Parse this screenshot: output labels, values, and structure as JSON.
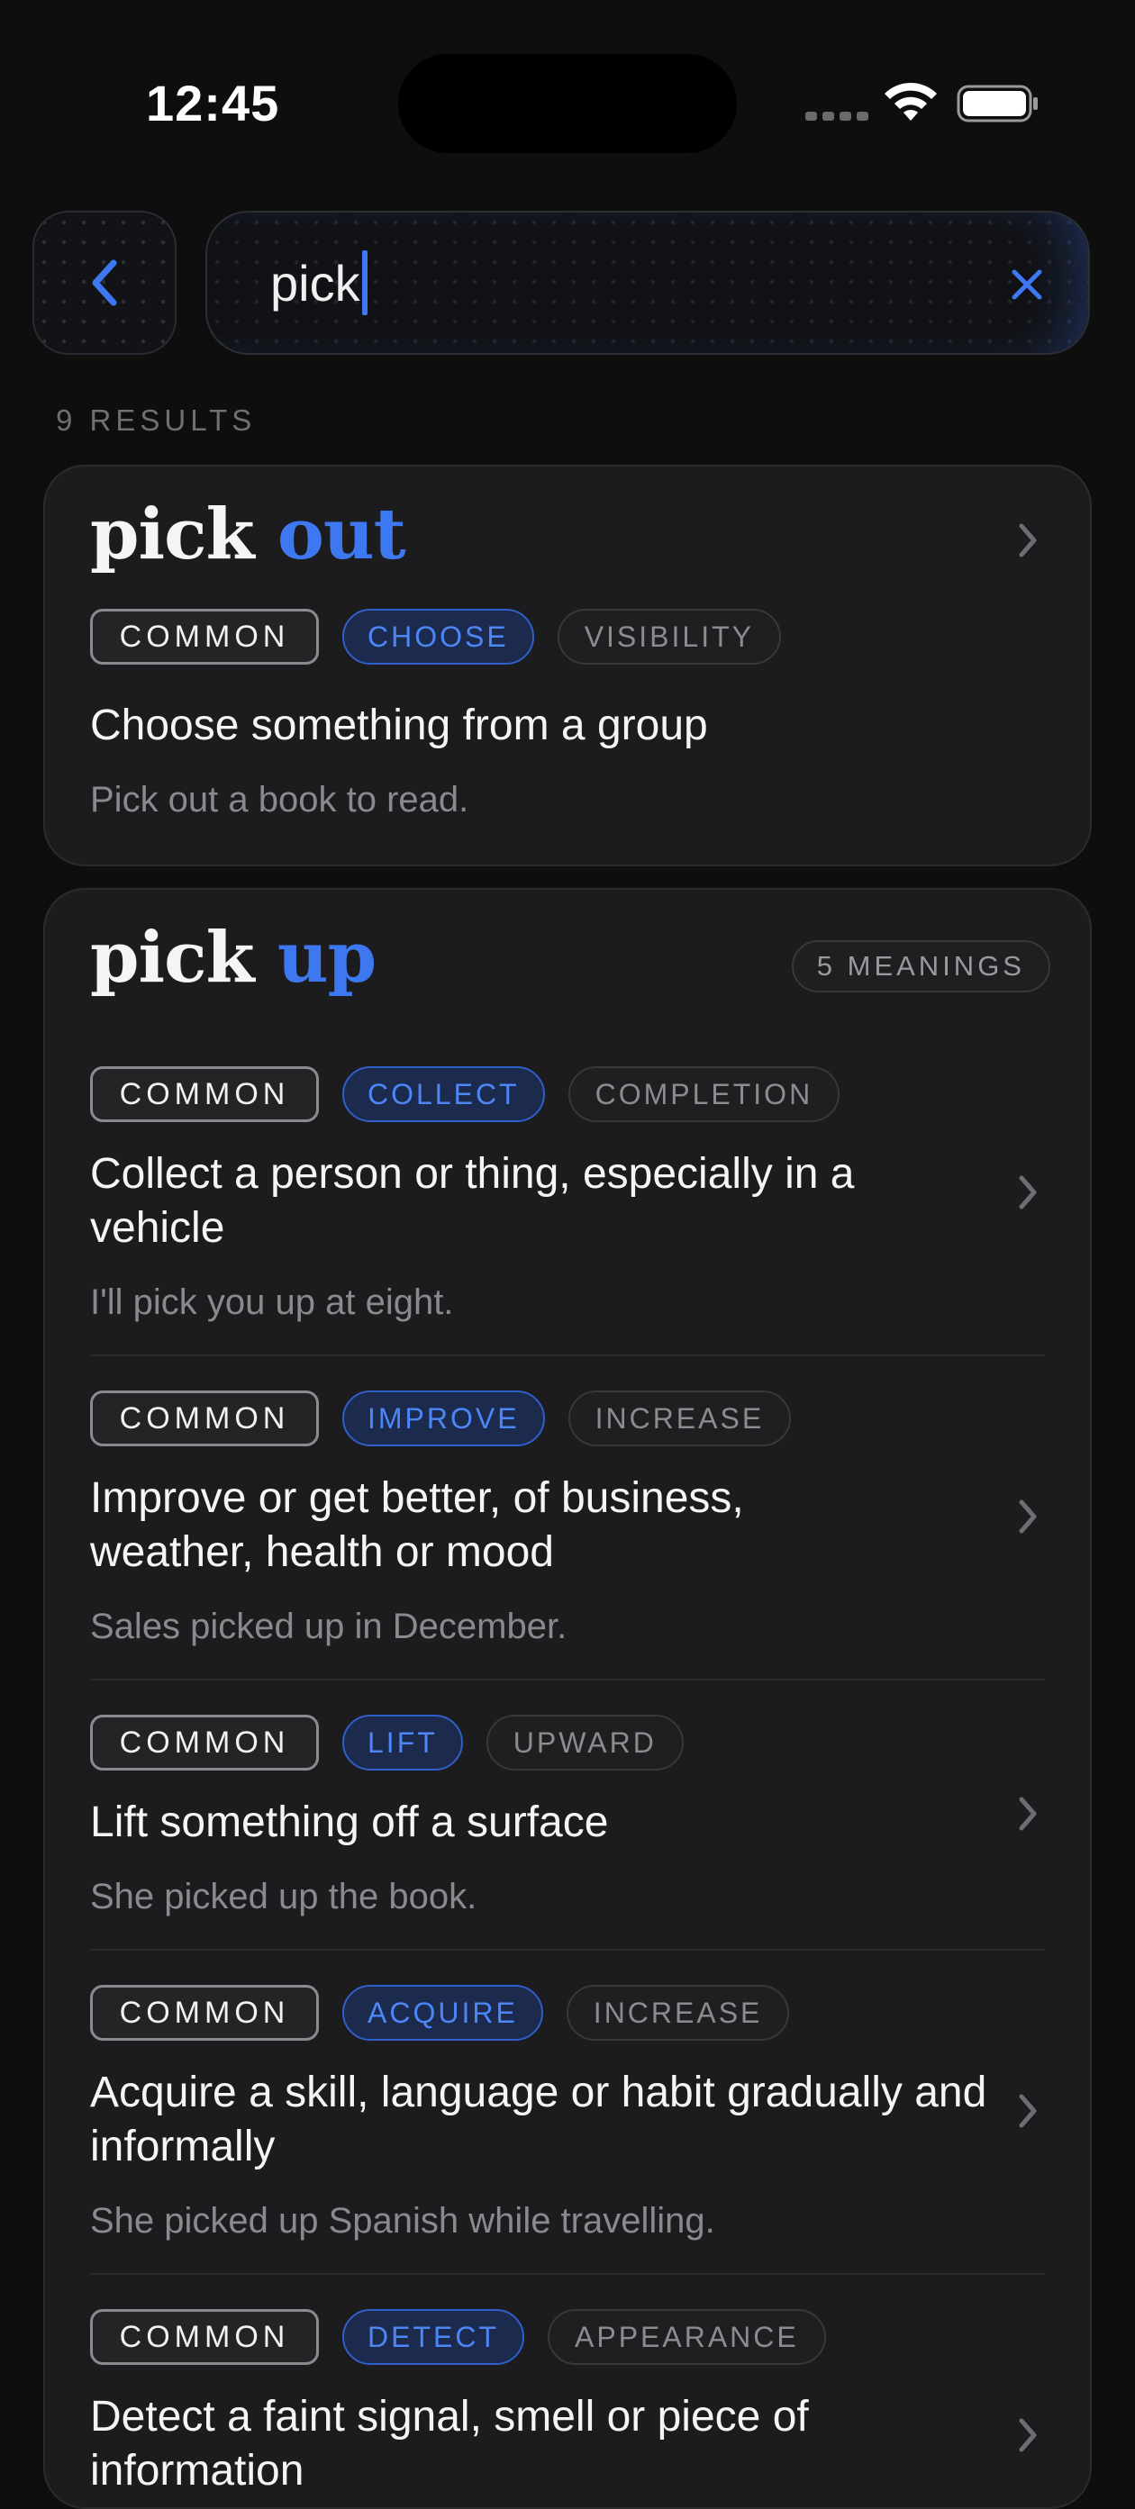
{
  "status_bar": {
    "time": "12:45"
  },
  "search": {
    "query": "pick"
  },
  "results": {
    "count_label": "9 RESULTS"
  },
  "entries": [
    {
      "verb": "pick",
      "particle": "out",
      "tags": {
        "frequency": "COMMON",
        "category": "CHOOSE",
        "domain": "VISIBILITY"
      },
      "definition": "Choose something from a group",
      "example": "Pick out a book to read."
    },
    {
      "verb": "pick",
      "particle": "up",
      "meanings_label": "5 MEANINGS",
      "meanings": [
        {
          "tags": {
            "frequency": "COMMON",
            "category": "COLLECT",
            "domain": "COMPLETION"
          },
          "definition": "Collect a person or thing, especially in a vehicle",
          "example": "I'll pick you up at eight."
        },
        {
          "tags": {
            "frequency": "COMMON",
            "category": "IMPROVE",
            "domain": "INCREASE"
          },
          "definition": "Improve or get better, of business, weather, health or mood",
          "example": "Sales picked up in December."
        },
        {
          "tags": {
            "frequency": "COMMON",
            "category": "LIFT",
            "domain": "UPWARD"
          },
          "definition": "Lift something off a surface",
          "example": "She picked up the book."
        },
        {
          "tags": {
            "frequency": "COMMON",
            "category": "ACQUIRE",
            "domain": "INCREASE"
          },
          "definition": "Acquire a skill, language or habit gradually and informally",
          "example": "She picked up Spanish while travelling."
        },
        {
          "tags": {
            "frequency": "COMMON",
            "category": "DETECT",
            "domain": "APPEARANCE"
          },
          "definition": "Detect a faint signal, smell or piece of information",
          "example": ""
        }
      ]
    }
  ],
  "colors": {
    "accent": "#3d78f0",
    "background": "#0e0e0f",
    "card": "#1c1c1e"
  }
}
